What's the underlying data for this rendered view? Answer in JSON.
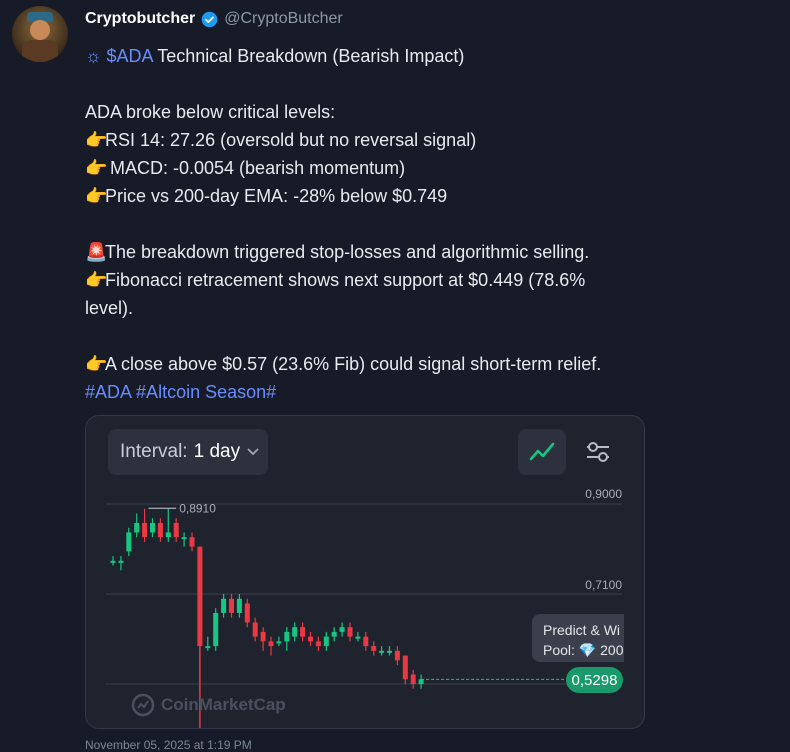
{
  "post": {
    "author_name": "Cryptobutcher",
    "handle": "@CryptoButcher",
    "title_icon": "☼",
    "title_ticker": "$ADA",
    "title_rest": " Technical Breakdown (Bearish Impact)",
    "intro": "ADA broke below critical levels:",
    "bullet_emoji": "👉",
    "siren_emoji": "🚨",
    "bullet1": "RSI 14: 27.26 (oversold but no reversal signal)",
    "bullet2": " MACD: -0.0054 (bearish momentum)",
    "bullet3": "Price vs 200-day EMA: -28% below $0.749",
    "siren_text": "The breakdown triggered stop-losses and algorithmic selling.",
    "fib_line1": "Fibonacci retracement shows next support at $0.449 (78.6%",
    "fib_line2": "level).",
    "close_text": "A close above $0.57 (23.6% Fib) could signal short-term relief.",
    "hashtag1": "#ADA",
    "hashtag2": "#Altcoin Season#",
    "timestamp": "November 05, 2025 at 1:19 PM"
  },
  "widget": {
    "interval_label": "Interval:",
    "interval_value": "1 day",
    "trend_icon": "trend-line-icon",
    "filter_icon": "sliders-icon",
    "grid_label_top": "0,9000",
    "grid_label_mid": "0,7100",
    "high_label": "0,8910",
    "predict_line1": "Predict & Wi",
    "predict_line2": "Pool: 💎 200",
    "price_label": "0,5298",
    "watermark": "CoinMarketCap",
    "colors": {
      "up": "#16c784",
      "down": "#ea3943",
      "bg": "#1f232d"
    }
  },
  "chart_data": {
    "type": "candlestick",
    "y_reference_lines": [
      0.9,
      0.71
    ],
    "high_marker": 0.891,
    "last_price": 0.5298,
    "candles": [
      {
        "o": 0.78,
        "c": 0.78,
        "h": 0.79,
        "l": 0.77
      },
      {
        "o": 0.78,
        "c": 0.78,
        "h": 0.79,
        "l": 0.76
      },
      {
        "o": 0.8,
        "c": 0.84,
        "h": 0.85,
        "l": 0.79
      },
      {
        "o": 0.84,
        "c": 0.86,
        "h": 0.88,
        "l": 0.83
      },
      {
        "o": 0.86,
        "c": 0.83,
        "h": 0.89,
        "l": 0.82
      },
      {
        "o": 0.84,
        "c": 0.86,
        "h": 0.87,
        "l": 0.83
      },
      {
        "o": 0.86,
        "c": 0.83,
        "h": 0.87,
        "l": 0.82
      },
      {
        "o": 0.83,
        "c": 0.84,
        "h": 0.89,
        "l": 0.82
      },
      {
        "o": 0.86,
        "c": 0.83,
        "h": 0.87,
        "l": 0.82
      },
      {
        "o": 0.83,
        "c": 0.83,
        "h": 0.84,
        "l": 0.81
      },
      {
        "o": 0.83,
        "c": 0.81,
        "h": 0.84,
        "l": 0.8
      },
      {
        "o": 0.81,
        "c": 0.6,
        "h": 0.81,
        "l": 0.5
      },
      {
        "o": 0.6,
        "c": 0.6,
        "h": 0.62,
        "l": 0.59
      },
      {
        "o": 0.6,
        "c": 0.67,
        "h": 0.68,
        "l": 0.59
      },
      {
        "o": 0.67,
        "c": 0.7,
        "h": 0.71,
        "l": 0.66
      },
      {
        "o": 0.7,
        "c": 0.67,
        "h": 0.71,
        "l": 0.66
      },
      {
        "o": 0.67,
        "c": 0.7,
        "h": 0.71,
        "l": 0.66
      },
      {
        "o": 0.69,
        "c": 0.65,
        "h": 0.7,
        "l": 0.64
      },
      {
        "o": 0.65,
        "c": 0.62,
        "h": 0.66,
        "l": 0.61
      },
      {
        "o": 0.63,
        "c": 0.61,
        "h": 0.64,
        "l": 0.59
      },
      {
        "o": 0.61,
        "c": 0.6,
        "h": 0.62,
        "l": 0.58
      },
      {
        "o": 0.61,
        "c": 0.61,
        "h": 0.62,
        "l": 0.6
      },
      {
        "o": 0.61,
        "c": 0.63,
        "h": 0.64,
        "l": 0.59
      },
      {
        "o": 0.62,
        "c": 0.64,
        "h": 0.65,
        "l": 0.61
      },
      {
        "o": 0.64,
        "c": 0.62,
        "h": 0.65,
        "l": 0.61
      },
      {
        "o": 0.62,
        "c": 0.61,
        "h": 0.63,
        "l": 0.6
      },
      {
        "o": 0.61,
        "c": 0.6,
        "h": 0.62,
        "l": 0.59
      },
      {
        "o": 0.6,
        "c": 0.62,
        "h": 0.63,
        "l": 0.59
      },
      {
        "o": 0.62,
        "c": 0.63,
        "h": 0.64,
        "l": 0.61
      },
      {
        "o": 0.63,
        "c": 0.64,
        "h": 0.65,
        "l": 0.62
      },
      {
        "o": 0.64,
        "c": 0.62,
        "h": 0.65,
        "l": 0.61
      },
      {
        "o": 0.62,
        "c": 0.62,
        "h": 0.63,
        "l": 0.61
      },
      {
        "o": 0.62,
        "c": 0.6,
        "h": 0.63,
        "l": 0.59
      },
      {
        "o": 0.6,
        "c": 0.59,
        "h": 0.61,
        "l": 0.58
      },
      {
        "o": 0.59,
        "c": 0.59,
        "h": 0.6,
        "l": 0.58
      },
      {
        "o": 0.59,
        "c": 0.59,
        "h": 0.6,
        "l": 0.58
      },
      {
        "o": 0.59,
        "c": 0.57,
        "h": 0.6,
        "l": 0.56
      },
      {
        "o": 0.58,
        "c": 0.53,
        "h": 0.58,
        "l": 0.52
      },
      {
        "o": 0.54,
        "c": 0.52,
        "h": 0.55,
        "l": 0.51
      },
      {
        "o": 0.52,
        "c": 0.53,
        "h": 0.54,
        "l": 0.51
      }
    ]
  }
}
